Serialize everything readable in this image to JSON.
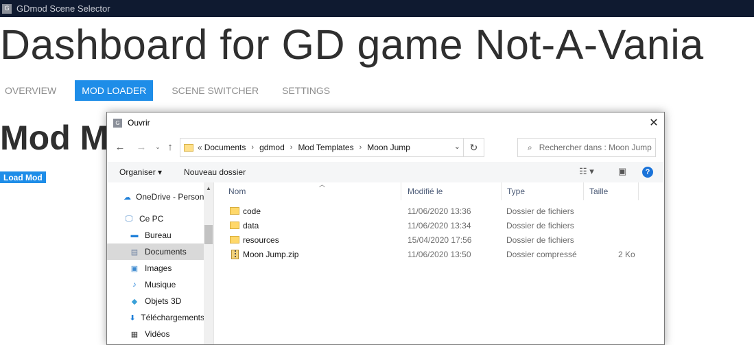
{
  "window": {
    "title": "GDmod Scene Selector",
    "icon_letter": "G"
  },
  "page": {
    "title": "Dashboard for GD game Not-A-Vania",
    "tabs": [
      {
        "label": "OVERVIEW",
        "active": false
      },
      {
        "label": "MOD LOADER",
        "active": true
      },
      {
        "label": "SCENE SWITCHER",
        "active": false
      },
      {
        "label": "SETTINGS",
        "active": false
      }
    ],
    "section_title": "Mod Manager",
    "load_button": "Load Mod"
  },
  "dialog": {
    "title": "Ouvrir",
    "icon_letter": "G",
    "close_glyph": "✕",
    "address": {
      "overflow": "«",
      "crumbs": [
        "Documents",
        "gdmod",
        "Mod Templates",
        "Moon Jump"
      ]
    },
    "search_placeholder": "Rechercher dans : Moon Jump",
    "toolbar": {
      "organize": "Organiser ▾",
      "new_folder": "Nouveau dossier",
      "help": "?"
    },
    "nav_items": [
      {
        "label": "OneDrive - Personal",
        "icon": "cloud-icon",
        "selected": false
      },
      {
        "label": "Ce PC",
        "icon": "computer-icon",
        "selected": false
      },
      {
        "label": "Bureau",
        "icon": "desktop-icon",
        "selected": false
      },
      {
        "label": "Documents",
        "icon": "documents-icon",
        "selected": true
      },
      {
        "label": "Images",
        "icon": "images-icon",
        "selected": false
      },
      {
        "label": "Musique",
        "icon": "music-icon",
        "selected": false
      },
      {
        "label": "Objets 3D",
        "icon": "objects-3d-icon",
        "selected": false
      },
      {
        "label": "Téléchargements",
        "icon": "downloads-icon",
        "selected": false
      },
      {
        "label": "Vidéos",
        "icon": "videos-icon",
        "selected": false
      }
    ],
    "columns": {
      "name": "Nom",
      "modified": "Modifié le",
      "type": "Type",
      "size": "Taille"
    },
    "files": [
      {
        "name": "code",
        "modified": "11/06/2020 13:36",
        "type": "Dossier de fichiers",
        "size": "",
        "icon": "folder-icon"
      },
      {
        "name": "data",
        "modified": "11/06/2020 13:34",
        "type": "Dossier de fichiers",
        "size": "",
        "icon": "folder-icon"
      },
      {
        "name": "resources",
        "modified": "15/04/2020 17:56",
        "type": "Dossier de fichiers",
        "size": "",
        "icon": "folder-icon"
      },
      {
        "name": "Moon Jump.zip",
        "modified": "11/06/2020 13:50",
        "type": "Dossier compressé",
        "size": "2 Ko",
        "icon": "zip-icon"
      }
    ]
  }
}
